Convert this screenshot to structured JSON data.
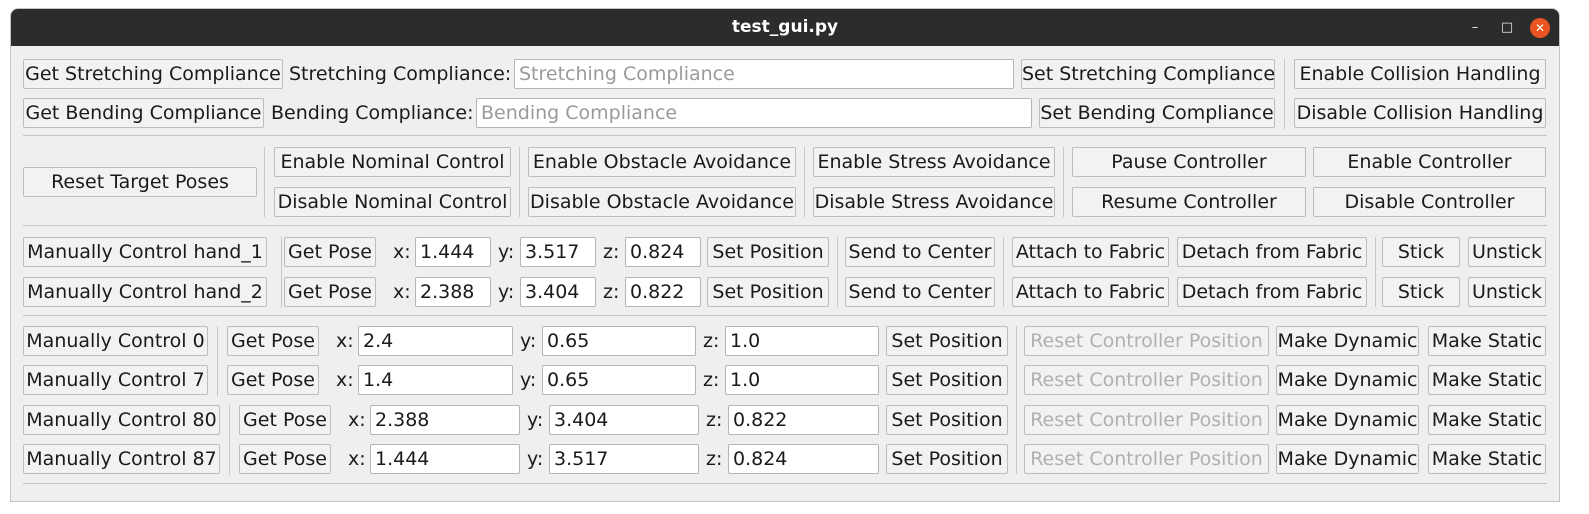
{
  "window": {
    "title": "test_gui.py",
    "minimize_glyph": "–",
    "maximize_glyph": "□",
    "close_glyph": "✕"
  },
  "compliance": {
    "stretch": {
      "get": "Get Stretching Compliance",
      "label": "Stretching Compliance:",
      "placeholder": "Stretching Compliance",
      "set": "Set Stretching Compliance"
    },
    "bend": {
      "get": "Get Bending Compliance",
      "label": "Bending Compliance:",
      "placeholder": "Bending Compliance",
      "set": "Set Bending Compliance"
    },
    "enable_collision": "Enable Collision Handling",
    "disable_collision": "Disable Collision Handling"
  },
  "controls": {
    "reset_target": "Reset Target Poses",
    "enable_nominal": "Enable Nominal Control",
    "disable_nominal": "Disable Nominal Control",
    "enable_obstacle": "Enable Obstacle Avoidance",
    "disable_obstacle": "Disable Obstacle Avoidance",
    "enable_stress": "Enable Stress Avoidance",
    "disable_stress": "Disable Stress Avoidance",
    "pause": "Pause Controller",
    "resume": "Resume Controller",
    "enable_controller": "Enable Controller",
    "disable_controller": "Disable Controller"
  },
  "hands": [
    {
      "manual": "Manually Control hand_1",
      "get_pose": "Get Pose",
      "x_label": "x:",
      "x": "1.444",
      "y_label": "y:",
      "y": "3.517",
      "z_label": "z:",
      "z": "0.824",
      "set_position": "Set Position",
      "send_center": "Send to Center",
      "attach": "Attach to Fabric",
      "detach": "Detach from Fabric",
      "stick": "Stick",
      "unstick": "Unstick"
    },
    {
      "manual": "Manually Control hand_2",
      "get_pose": "Get Pose",
      "x_label": "x:",
      "x": "2.388",
      "y_label": "y:",
      "y": "3.404",
      "z_label": "z:",
      "z": "0.822",
      "set_position": "Set Position",
      "send_center": "Send to Center",
      "attach": "Attach to Fabric",
      "detach": "Detach from Fabric",
      "stick": "Stick",
      "unstick": "Unstick"
    }
  ],
  "particles": [
    {
      "manual": "Manually Control 0",
      "get_pose": "Get Pose",
      "x_label": "x:",
      "x": "2.4",
      "y_label": "y:",
      "y": "0.65",
      "z_label": "z:",
      "z": "1.0",
      "set_position": "Set Position",
      "reset": "Reset Controller Position",
      "dynamic": "Make Dynamic",
      "static": "Make Static"
    },
    {
      "manual": "Manually Control 7",
      "get_pose": "Get Pose",
      "x_label": "x:",
      "x": "1.4",
      "y_label": "y:",
      "y": "0.65",
      "z_label": "z:",
      "z": "1.0",
      "set_position": "Set Position",
      "reset": "Reset Controller Position",
      "dynamic": "Make Dynamic",
      "static": "Make Static"
    },
    {
      "manual": "Manually Control 80",
      "get_pose": "Get Pose",
      "x_label": "x:",
      "x": "2.388",
      "y_label": "y:",
      "y": "3.404",
      "z_label": "z:",
      "z": "0.822",
      "set_position": "Set Position",
      "reset": "Reset Controller Position",
      "dynamic": "Make Dynamic",
      "static": "Make Static"
    },
    {
      "manual": "Manually Control 87",
      "get_pose": "Get Pose",
      "x_label": "x:",
      "x": "1.444",
      "y_label": "y:",
      "y": "3.517",
      "z_label": "z:",
      "z": "0.824",
      "set_position": "Set Position",
      "reset": "Reset Controller Position",
      "dynamic": "Make Dynamic",
      "static": "Make Static"
    }
  ]
}
